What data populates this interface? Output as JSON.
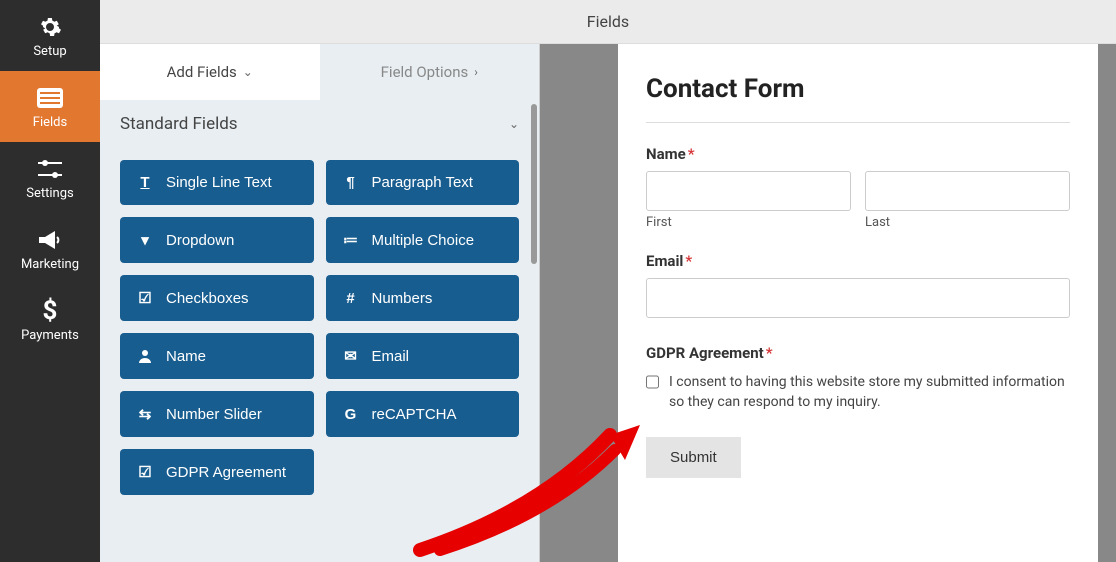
{
  "topbar": {
    "title": "Fields"
  },
  "sidebar": {
    "items": [
      {
        "label": "Setup",
        "icon": "gear"
      },
      {
        "label": "Fields",
        "icon": "list"
      },
      {
        "label": "Settings",
        "icon": "sliders"
      },
      {
        "label": "Marketing",
        "icon": "megaphone"
      },
      {
        "label": "Payments",
        "icon": "dollar"
      }
    ]
  },
  "panel": {
    "tabs": {
      "add": "Add Fields",
      "options": "Field Options"
    },
    "section": "Standard Fields",
    "fields": [
      {
        "label": "Single Line Text",
        "icon": "T"
      },
      {
        "label": "Paragraph Text",
        "icon": "¶"
      },
      {
        "label": "Dropdown",
        "icon": "▾"
      },
      {
        "label": "Multiple Choice",
        "icon": "≡"
      },
      {
        "label": "Checkboxes",
        "icon": "☑"
      },
      {
        "label": "Numbers",
        "icon": "#"
      },
      {
        "label": "Name",
        "icon": "👤"
      },
      {
        "label": "Email",
        "icon": "✉"
      },
      {
        "label": "Number Slider",
        "icon": "⇄"
      },
      {
        "label": "reCAPTCHA",
        "icon": "G"
      },
      {
        "label": "GDPR Agreement",
        "icon": "☑"
      }
    ]
  },
  "preview": {
    "title": "Contact Form",
    "name_label": "Name",
    "first_label": "First",
    "last_label": "Last",
    "email_label": "Email",
    "gdpr_label": "GDPR Agreement",
    "consent_text": "I consent to having this website store my submitted information so they can respond to my inquiry.",
    "submit_label": "Submit"
  }
}
